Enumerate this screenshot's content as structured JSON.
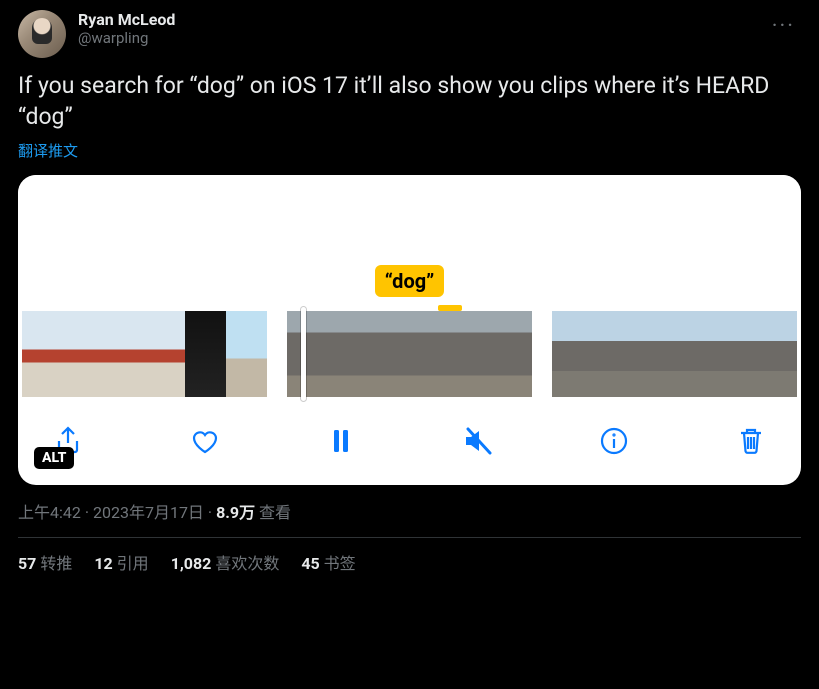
{
  "author": {
    "display_name": "Ryan McLeod",
    "handle": "@warpling"
  },
  "more_label": "···",
  "tweet_text": "If you search for “dog” on iOS 17 it’ll also show you clips where it’s HEARD “dog”",
  "translate_label": "翻译推文",
  "media": {
    "search_token": "“dog”",
    "alt_label": "ALT",
    "toolbar": {
      "share": "share",
      "like": "like",
      "pause": "pause",
      "mute": "mute",
      "info": "info",
      "delete": "delete"
    }
  },
  "meta": {
    "time": "上午4:42",
    "sep": " · ",
    "date": "2023年7月17日",
    "views_count": "8.9万",
    "views_label": " 查看"
  },
  "stats": {
    "retweets": {
      "n": "57",
      "label": " 转推"
    },
    "quotes": {
      "n": "12",
      "label": " 引用"
    },
    "likes": {
      "n": "1,082",
      "label": " 喜欢次数"
    },
    "bookmarks": {
      "n": "45",
      "label": " 书签"
    }
  }
}
